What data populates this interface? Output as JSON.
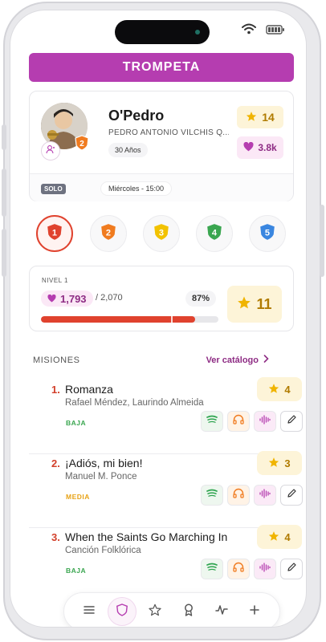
{
  "header": {
    "title": "TROMPETA"
  },
  "profile": {
    "name": "O'Pedro",
    "full_name": "PEDRO ANTONIO VILCHIS Q...",
    "age": "30 Años",
    "avatar_level": "2",
    "stars": "14",
    "hearts": "3.8k",
    "mode_tag": "SOLO",
    "schedule": "Miércoles - 15:00"
  },
  "levels": {
    "items": [
      {
        "label": "1",
        "color": "#e0422e"
      },
      {
        "label": "2",
        "color": "#f07b1f"
      },
      {
        "label": "3",
        "color": "#f2c200"
      },
      {
        "label": "4",
        "color": "#3aa650"
      },
      {
        "label": "5",
        "color": "#3a86e0"
      }
    ],
    "active_index": 0
  },
  "progress": {
    "level_label": "NIVEL 1",
    "points": "1,793",
    "total": "/ 2,070",
    "percent_label": "87%",
    "fraction": 0.87,
    "level_stars": "11"
  },
  "missions": {
    "header": "MISIONES",
    "catalog_link": "Ver catálogo",
    "items": [
      {
        "number": "1.",
        "title": "Romanza",
        "artist": "Rafael Méndez, Laurindo Almeida",
        "difficulty": "BAJA",
        "difficulty_color": "#3aa650",
        "stars": "4"
      },
      {
        "number": "2.",
        "title": "¡Adiós, mi bien!",
        "artist": "Manuel M. Ponce",
        "difficulty": "MEDIA",
        "difficulty_color": "#e8a317",
        "stars": "3"
      },
      {
        "number": "3.",
        "title": "When the Saints Go Marching In",
        "artist": "Canción Folklórica",
        "difficulty": "BAJA",
        "difficulty_color": "#3aa650",
        "stars": "4"
      }
    ]
  },
  "nav": {
    "items": [
      "menu-icon",
      "shield-icon",
      "star-icon",
      "award-icon",
      "activity-icon",
      "plus-icon"
    ],
    "active": "shield-icon"
  },
  "colors": {
    "accent": "#b53db0",
    "heart": "#b53db0",
    "star": "#f0b400",
    "danger": "#e0422e"
  }
}
